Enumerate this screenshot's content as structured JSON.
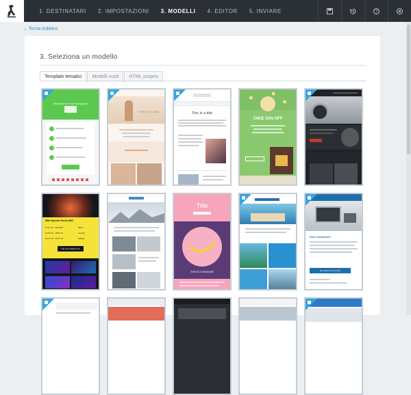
{
  "steps": [
    "1. DESTINATARI",
    "2. IMPOSTAZIONI",
    "3. MODELLI",
    "4. EDITOR",
    "5. INVIARE"
  ],
  "active_step": 2,
  "tool_icons": [
    "save-icon",
    "history-icon",
    "help-icon",
    "close-icon"
  ],
  "back_link": "Torna indietro",
  "page_title": "3. Seleziona un modello",
  "tabs": [
    "Template tematici",
    "Modelli vuoti",
    "HTML proprio"
  ],
  "templates": {
    "t1": {
      "heading": "Welcome to Your Company!"
    },
    "t2": {
      "dress": "DRESS CODE"
    },
    "t3": {
      "title": "This is a title"
    },
    "t4": {
      "offer": "TAKE 15% OFF"
    },
    "t5": {},
    "t6": {
      "special": "With Special Guest ABC",
      "rows": [
        [
          "27.07.15 - 15.06.15",
          "Berlin"
        ],
        [
          "12.06.15 - 18.06.15",
          "London"
        ],
        [
          "06.07.15 - 15.07.15",
          "Madrid"
        ]
      ],
      "button": "Get your tickets now"
    },
    "t7": {},
    "t8": {
      "title": "Title",
      "headline": "THIS IS A HEADLINE"
    },
    "t9": {},
    "t10": {
      "greeting": "Dear Customers",
      "button": "Say Hello to the future!"
    }
  },
  "colors": {
    "topbar": "#2b2f36",
    "accent": "#33a5e1",
    "panel": "#ffffff",
    "background": "#eceff1"
  }
}
